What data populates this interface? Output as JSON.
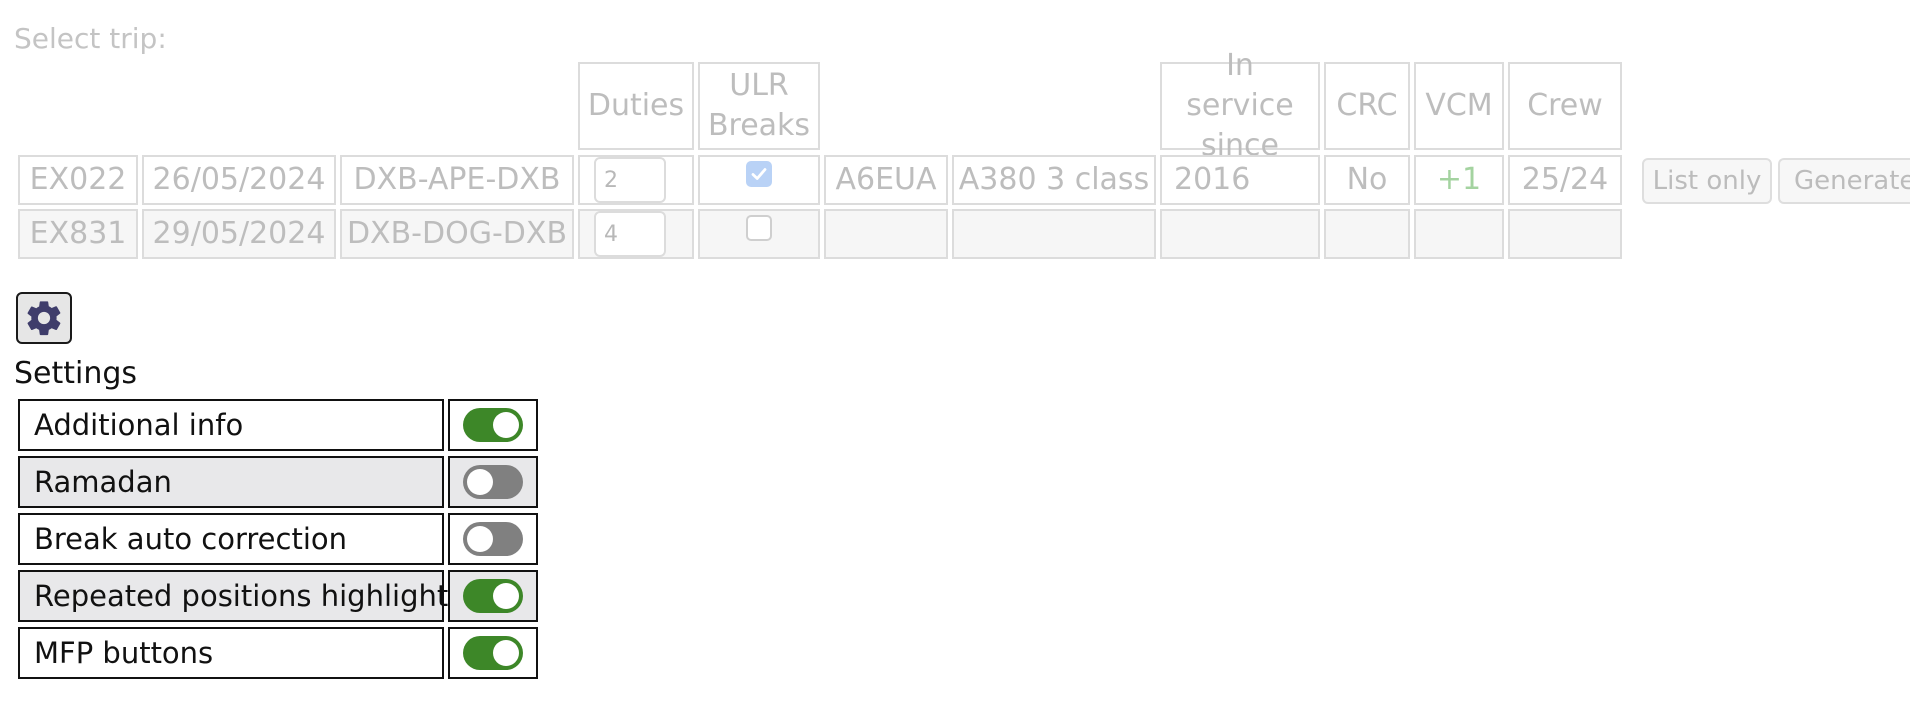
{
  "select_label": "Select trip:",
  "headers": {
    "duties": "Duties",
    "ulr_breaks": "ULR Breaks",
    "in_service_since": "In service since",
    "crc": "CRC",
    "vcm": "VCM",
    "crew": "Crew"
  },
  "trips": [
    {
      "flight": "EX022",
      "date": "26/05/2024",
      "route": "DXB-APE-DXB",
      "duties": "2",
      "ulr_breaks_checked": true,
      "registration": "A6EUA",
      "aircraft": "A380 3 class",
      "in_service_since": "2016",
      "crc": "No",
      "vcm": "+1",
      "crew": "25/24"
    },
    {
      "flight": "EX831",
      "date": "29/05/2024",
      "route": "DXB-DOG-DXB",
      "duties": "4",
      "ulr_breaks_checked": false,
      "registration": "",
      "aircraft": "",
      "in_service_since": "",
      "crc": "",
      "vcm": "",
      "crew": ""
    }
  ],
  "buttons": {
    "list_only": "List only",
    "generate": "Generate"
  },
  "settings": {
    "title": "Settings",
    "items": [
      {
        "label": "Additional info",
        "on": true
      },
      {
        "label": "Ramadan",
        "on": false
      },
      {
        "label": "Break auto correction",
        "on": false
      },
      {
        "label": "Repeated positions highlight",
        "on": true
      },
      {
        "label": "MFP buttons",
        "on": true
      }
    ]
  },
  "colors": {
    "toggle_on": "#3d8728",
    "toggle_off": "#808080",
    "gear": "#3f3d6b"
  },
  "icons": {
    "settings": "gear-icon",
    "checkbox_checked": "check-icon"
  }
}
